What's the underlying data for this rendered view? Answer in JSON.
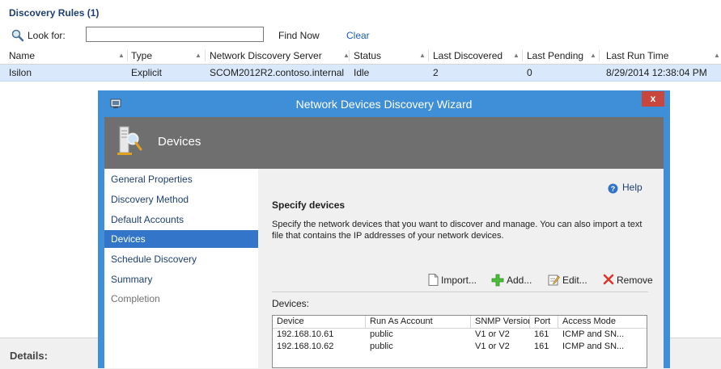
{
  "rules": {
    "title": "Discovery Rules (1)",
    "look_for_label": "Look for:",
    "search_value": "",
    "find_now": "Find Now",
    "clear": "Clear",
    "columns": [
      "Name",
      "Type",
      "Network Discovery Server",
      "Status",
      "Last Discovered",
      "Last Pending",
      "Last Run Time"
    ],
    "rows": [
      {
        "name": "Isilon",
        "type": "Explicit",
        "server": "SCOM2012R2.contoso.internal",
        "status": "Idle",
        "last_discovered": "2",
        "last_pending": "0",
        "last_run_time": "8/29/2014 12:38:04 PM"
      }
    ]
  },
  "details": {
    "label": "Details:"
  },
  "wizard": {
    "title": "Network Devices Discovery Wizard",
    "close_label": "x",
    "banner_title": "Devices",
    "nav": [
      {
        "label": "General Properties",
        "state": "normal"
      },
      {
        "label": "Discovery Method",
        "state": "normal"
      },
      {
        "label": "Default Accounts",
        "state": "normal"
      },
      {
        "label": "Devices",
        "state": "active"
      },
      {
        "label": "Schedule Discovery",
        "state": "normal"
      },
      {
        "label": "Summary",
        "state": "normal"
      },
      {
        "label": "Completion",
        "state": "disabled"
      }
    ],
    "help": "Help",
    "section_title": "Specify devices",
    "section_desc": "Specify the network devices that you want to discover and manage. You can also import a text file that contains the IP addresses of your network devices.",
    "toolbar": {
      "import": "Import...",
      "add": "Add...",
      "edit": "Edit...",
      "remove": "Remove"
    },
    "devices_label": "Devices:",
    "device_columns": [
      "Device",
      "Run As Account",
      "SNMP Version",
      "Port",
      "Access Mode"
    ],
    "devices": [
      {
        "device": "192.168.10.61",
        "run_as": "public",
        "snmp": "V1 or V2",
        "port": "161",
        "mode": "ICMP and SN..."
      },
      {
        "device": "192.168.10.62",
        "run_as": "public",
        "snmp": "V1 or V2",
        "port": "161",
        "mode": "ICMP and SN..."
      }
    ]
  },
  "colors": {
    "wizard_frame": "#3f8ed8",
    "banner": "#6f6f6f",
    "nav_active": "#3275c9",
    "selected_row": "#d9e8fb",
    "close_button": "#c9463d"
  }
}
